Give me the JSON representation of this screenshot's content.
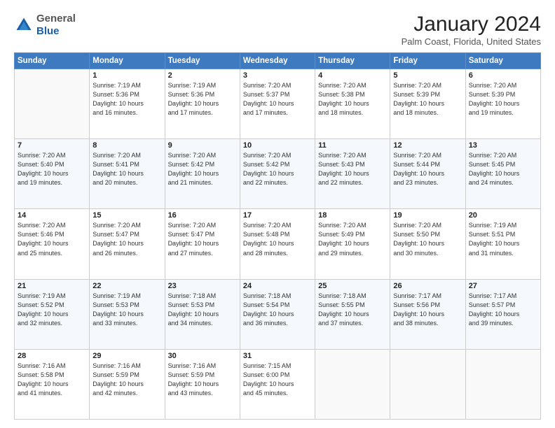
{
  "header": {
    "logo": {
      "general": "General",
      "blue": "Blue"
    },
    "title": "January 2024",
    "subtitle": "Palm Coast, Florida, United States"
  },
  "weekdays": [
    "Sunday",
    "Monday",
    "Tuesday",
    "Wednesday",
    "Thursday",
    "Friday",
    "Saturday"
  ],
  "weeks": [
    [
      {
        "day": "",
        "info": ""
      },
      {
        "day": "1",
        "info": "Sunrise: 7:19 AM\nSunset: 5:36 PM\nDaylight: 10 hours\nand 16 minutes."
      },
      {
        "day": "2",
        "info": "Sunrise: 7:19 AM\nSunset: 5:36 PM\nDaylight: 10 hours\nand 17 minutes."
      },
      {
        "day": "3",
        "info": "Sunrise: 7:20 AM\nSunset: 5:37 PM\nDaylight: 10 hours\nand 17 minutes."
      },
      {
        "day": "4",
        "info": "Sunrise: 7:20 AM\nSunset: 5:38 PM\nDaylight: 10 hours\nand 18 minutes."
      },
      {
        "day": "5",
        "info": "Sunrise: 7:20 AM\nSunset: 5:39 PM\nDaylight: 10 hours\nand 18 minutes."
      },
      {
        "day": "6",
        "info": "Sunrise: 7:20 AM\nSunset: 5:39 PM\nDaylight: 10 hours\nand 19 minutes."
      }
    ],
    [
      {
        "day": "7",
        "info": "Sunrise: 7:20 AM\nSunset: 5:40 PM\nDaylight: 10 hours\nand 19 minutes."
      },
      {
        "day": "8",
        "info": "Sunrise: 7:20 AM\nSunset: 5:41 PM\nDaylight: 10 hours\nand 20 minutes."
      },
      {
        "day": "9",
        "info": "Sunrise: 7:20 AM\nSunset: 5:42 PM\nDaylight: 10 hours\nand 21 minutes."
      },
      {
        "day": "10",
        "info": "Sunrise: 7:20 AM\nSunset: 5:42 PM\nDaylight: 10 hours\nand 22 minutes."
      },
      {
        "day": "11",
        "info": "Sunrise: 7:20 AM\nSunset: 5:43 PM\nDaylight: 10 hours\nand 22 minutes."
      },
      {
        "day": "12",
        "info": "Sunrise: 7:20 AM\nSunset: 5:44 PM\nDaylight: 10 hours\nand 23 minutes."
      },
      {
        "day": "13",
        "info": "Sunrise: 7:20 AM\nSunset: 5:45 PM\nDaylight: 10 hours\nand 24 minutes."
      }
    ],
    [
      {
        "day": "14",
        "info": "Sunrise: 7:20 AM\nSunset: 5:46 PM\nDaylight: 10 hours\nand 25 minutes."
      },
      {
        "day": "15",
        "info": "Sunrise: 7:20 AM\nSunset: 5:47 PM\nDaylight: 10 hours\nand 26 minutes."
      },
      {
        "day": "16",
        "info": "Sunrise: 7:20 AM\nSunset: 5:47 PM\nDaylight: 10 hours\nand 27 minutes."
      },
      {
        "day": "17",
        "info": "Sunrise: 7:20 AM\nSunset: 5:48 PM\nDaylight: 10 hours\nand 28 minutes."
      },
      {
        "day": "18",
        "info": "Sunrise: 7:20 AM\nSunset: 5:49 PM\nDaylight: 10 hours\nand 29 minutes."
      },
      {
        "day": "19",
        "info": "Sunrise: 7:20 AM\nSunset: 5:50 PM\nDaylight: 10 hours\nand 30 minutes."
      },
      {
        "day": "20",
        "info": "Sunrise: 7:19 AM\nSunset: 5:51 PM\nDaylight: 10 hours\nand 31 minutes."
      }
    ],
    [
      {
        "day": "21",
        "info": "Sunrise: 7:19 AM\nSunset: 5:52 PM\nDaylight: 10 hours\nand 32 minutes."
      },
      {
        "day": "22",
        "info": "Sunrise: 7:19 AM\nSunset: 5:53 PM\nDaylight: 10 hours\nand 33 minutes."
      },
      {
        "day": "23",
        "info": "Sunrise: 7:18 AM\nSunset: 5:53 PM\nDaylight: 10 hours\nand 34 minutes."
      },
      {
        "day": "24",
        "info": "Sunrise: 7:18 AM\nSunset: 5:54 PM\nDaylight: 10 hours\nand 36 minutes."
      },
      {
        "day": "25",
        "info": "Sunrise: 7:18 AM\nSunset: 5:55 PM\nDaylight: 10 hours\nand 37 minutes."
      },
      {
        "day": "26",
        "info": "Sunrise: 7:17 AM\nSunset: 5:56 PM\nDaylight: 10 hours\nand 38 minutes."
      },
      {
        "day": "27",
        "info": "Sunrise: 7:17 AM\nSunset: 5:57 PM\nDaylight: 10 hours\nand 39 minutes."
      }
    ],
    [
      {
        "day": "28",
        "info": "Sunrise: 7:16 AM\nSunset: 5:58 PM\nDaylight: 10 hours\nand 41 minutes."
      },
      {
        "day": "29",
        "info": "Sunrise: 7:16 AM\nSunset: 5:59 PM\nDaylight: 10 hours\nand 42 minutes."
      },
      {
        "day": "30",
        "info": "Sunrise: 7:16 AM\nSunset: 5:59 PM\nDaylight: 10 hours\nand 43 minutes."
      },
      {
        "day": "31",
        "info": "Sunrise: 7:15 AM\nSunset: 6:00 PM\nDaylight: 10 hours\nand 45 minutes."
      },
      {
        "day": "",
        "info": ""
      },
      {
        "day": "",
        "info": ""
      },
      {
        "day": "",
        "info": ""
      }
    ]
  ]
}
